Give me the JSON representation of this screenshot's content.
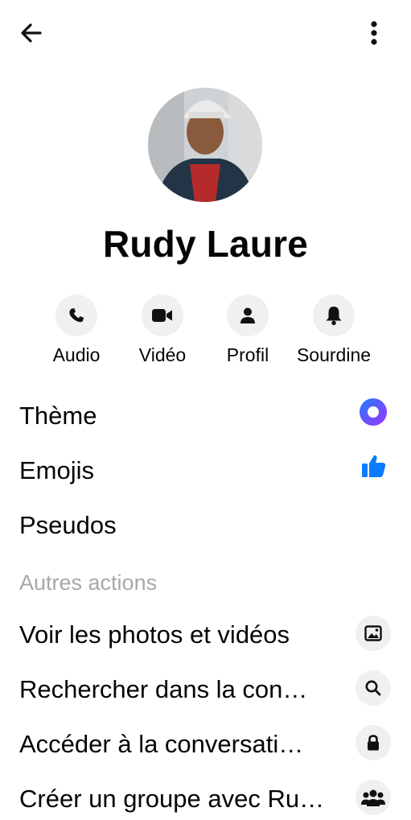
{
  "header": {
    "back_icon": "arrow-left-icon",
    "menu_icon": "more-vertical-icon"
  },
  "profile": {
    "name": "Rudy Laure"
  },
  "actions": [
    {
      "label": "Audio",
      "icon": "phone-icon"
    },
    {
      "label": "Vidéo",
      "icon": "video-camera-icon"
    },
    {
      "label": "Profil",
      "icon": "person-icon"
    },
    {
      "label": "Sourdine",
      "icon": "bell-icon"
    }
  ],
  "customize": [
    {
      "label": "Thème",
      "icon": "theme-circle-icon"
    },
    {
      "label": "Emojis",
      "icon": "thumbs-up-icon"
    },
    {
      "label": "Pseudos"
    }
  ],
  "other_actions": {
    "title": "Autres actions",
    "items": [
      {
        "label": "Voir les photos et vidéos",
        "icon": "image-icon"
      },
      {
        "label": "Rechercher dans la con…",
        "icon": "search-icon"
      },
      {
        "label": "Accéder à la conversati…",
        "icon": "lock-icon"
      },
      {
        "label": "Créer un groupe avec Ru…",
        "icon": "group-icon"
      }
    ]
  },
  "colors": {
    "accent": "#0a7cff",
    "theme_gradient_start": "#1f7bff",
    "theme_gradient_end": "#a033ff",
    "muted": "#a8a8a8"
  }
}
